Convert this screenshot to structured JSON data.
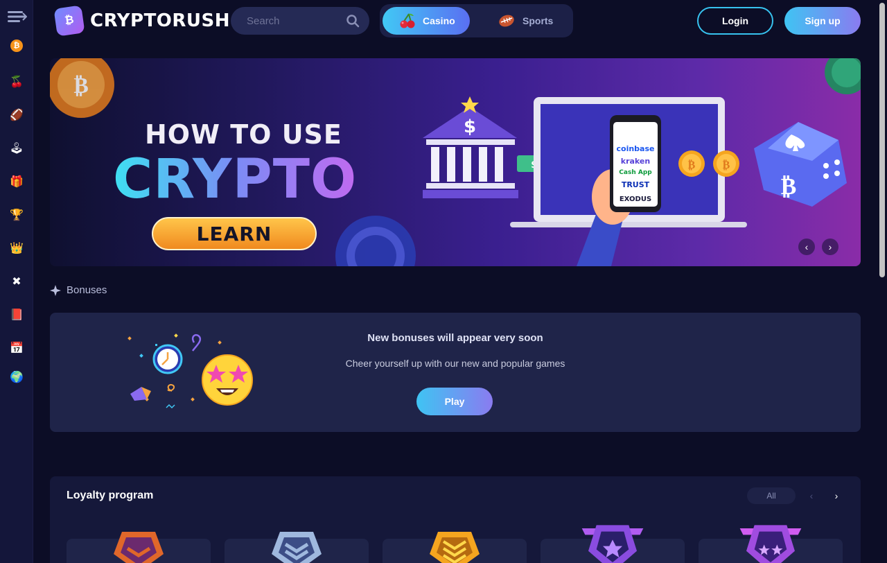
{
  "brand": {
    "name": "CRYPTORUSH",
    "accent": "#41c8f5",
    "accent2": "#8a7bf0"
  },
  "search": {
    "placeholder": "Search"
  },
  "modes": [
    {
      "label": "Casino",
      "icon": "cherry-icon",
      "active": true
    },
    {
      "label": "Sports",
      "icon": "basketball-icon",
      "active": false
    }
  ],
  "auth": {
    "login": "Login",
    "signup": "Sign up"
  },
  "sidebar": {
    "items": [
      {
        "icon": "bitcoin-icon",
        "glyph": "₿"
      },
      {
        "icon": "cherry-icon",
        "glyph": "🍒"
      },
      {
        "icon": "sports-ball-icon",
        "glyph": "🏈"
      },
      {
        "icon": "joystick-icon",
        "glyph": "🕹"
      },
      {
        "icon": "gift-icon",
        "glyph": "🎁"
      },
      {
        "icon": "trophy-icon",
        "glyph": "🏆"
      },
      {
        "icon": "crown-icon",
        "glyph": "👑"
      },
      {
        "icon": "close-x-icon",
        "glyph": "✖"
      },
      {
        "icon": "book-icon",
        "glyph": "📕"
      },
      {
        "icon": "calendar-icon",
        "glyph": "📅"
      },
      {
        "icon": "globe-icon",
        "glyph": "🌍"
      }
    ]
  },
  "banner": {
    "line1": "HOW TO USE",
    "line2": "CRYPTO",
    "cta": "LEARN",
    "phone_apps": [
      "coinbase",
      "kraken",
      "Cash App",
      "TRUST",
      "EXODUS"
    ]
  },
  "bonuses": {
    "section_label": "Bonuses",
    "title": "New bonuses will appear very soon",
    "description": "Cheer yourself up with our new and popular games",
    "play": "Play"
  },
  "loyalty": {
    "title": "Loyalty program",
    "all": "All"
  }
}
